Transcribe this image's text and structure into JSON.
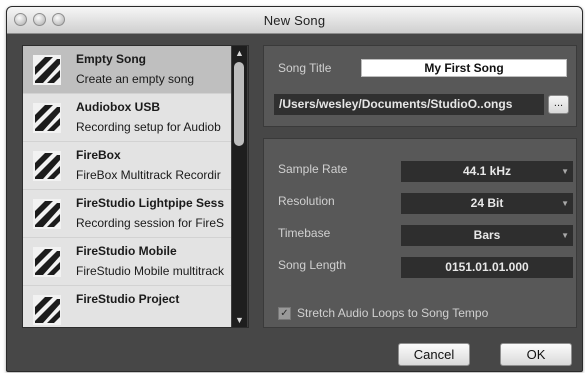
{
  "window": {
    "title": "New Song"
  },
  "template_list": {
    "items": [
      {
        "name": "Empty Song",
        "description": "Create an empty song",
        "icon": "presonus-icon",
        "selected": true
      },
      {
        "name": "Audiobox USB",
        "description": "Recording setup for Audiob",
        "icon": "presonus-icon",
        "selected": false
      },
      {
        "name": "FireBox",
        "description": "FireBox Multitrack Recordir",
        "icon": "presonus-icon",
        "selected": false
      },
      {
        "name": "FireStudio Lightpipe Sess",
        "description": "Recording session for FireS",
        "icon": "presonus-icon",
        "selected": false
      },
      {
        "name": "FireStudio Mobile",
        "description": "FireStudio Mobile multitrack",
        "icon": "presonus-icon",
        "selected": false
      },
      {
        "name": "FireStudio Project",
        "description": "",
        "icon": "presonus-icon",
        "selected": false
      }
    ]
  },
  "song": {
    "title_label": "Song Title",
    "title_value": "My First Song",
    "path_value": "/Users/wesley/Documents/StudioO..ongs",
    "browse_label": "..."
  },
  "settings": {
    "sample_rate_label": "Sample Rate",
    "sample_rate_value": "44.1 kHz",
    "resolution_label": "Resolution",
    "resolution_value": "24 Bit",
    "timebase_label": "Timebase",
    "timebase_value": "Bars",
    "song_length_label": "Song Length",
    "song_length_value": "0151.01.01.000",
    "stretch_label": "Stretch Audio Loops to Song Tempo",
    "stretch_checked": true
  },
  "buttons": {
    "cancel": "Cancel",
    "ok": "OK"
  },
  "colors": {
    "window_bg": "#474747",
    "panel_bg": "#585858",
    "selected_item": "#bfbfbf",
    "item_bg": "#e3e3e3"
  }
}
